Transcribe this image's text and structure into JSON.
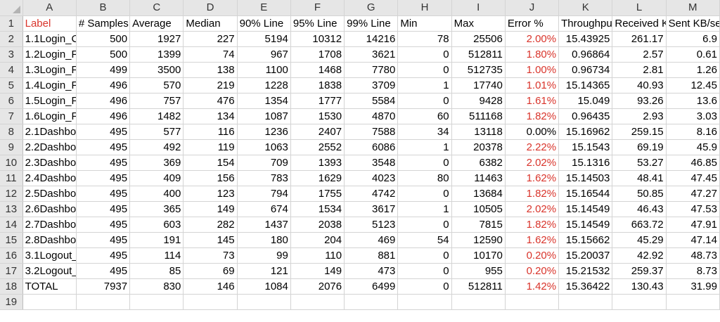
{
  "columns": [
    "A",
    "B",
    "C",
    "D",
    "E",
    "F",
    "G",
    "H",
    "I",
    "J",
    "K",
    "L",
    "M"
  ],
  "header_row": {
    "num": "1",
    "cells": [
      "Label",
      "# Samples",
      "Average",
      "Median",
      "90% Line",
      "95% Line",
      "99% Line",
      "Min",
      "Max",
      "Error %",
      "Throughput",
      "Received KB/sec",
      "Sent KB/sec"
    ]
  },
  "rows": [
    {
      "num": "2",
      "cells": [
        "1.1Login_C",
        "500",
        "1927",
        "227",
        "5194",
        "10312",
        "14216",
        "78",
        "25506",
        "2.00%",
        "15.43925",
        "261.17",
        "6.9"
      ]
    },
    {
      "num": "3",
      "cells": [
        "1.2Login_F",
        "500",
        "1399",
        "74",
        "967",
        "1708",
        "3621",
        "0",
        "512811",
        "1.80%",
        "0.96864",
        "2.57",
        "0.61"
      ]
    },
    {
      "num": "4",
      "cells": [
        "1.3Login_F",
        "499",
        "3500",
        "138",
        "1100",
        "1468",
        "7780",
        "0",
        "512735",
        "1.00%",
        "0.96734",
        "2.81",
        "1.26"
      ]
    },
    {
      "num": "5",
      "cells": [
        "1.4Login_F",
        "496",
        "570",
        "219",
        "1228",
        "1838",
        "3709",
        "1",
        "17740",
        "1.01%",
        "15.14365",
        "40.93",
        "12.45"
      ]
    },
    {
      "num": "6",
      "cells": [
        "1.5Login_F",
        "496",
        "757",
        "476",
        "1354",
        "1777",
        "5584",
        "0",
        "9428",
        "1.61%",
        "15.049",
        "93.26",
        "13.6"
      ]
    },
    {
      "num": "7",
      "cells": [
        "1.6Login_F",
        "496",
        "1482",
        "134",
        "1087",
        "1530",
        "4870",
        "60",
        "511168",
        "1.82%",
        "0.96435",
        "2.93",
        "3.03"
      ]
    },
    {
      "num": "8",
      "cells": [
        "2.1Dashbo",
        "495",
        "577",
        "116",
        "1236",
        "2407",
        "7588",
        "34",
        "13118",
        "0.00%",
        "15.16962",
        "259.15",
        "8.16"
      ]
    },
    {
      "num": "9",
      "cells": [
        "2.2Dashbo",
        "495",
        "492",
        "119",
        "1063",
        "2552",
        "6086",
        "1",
        "20378",
        "2.22%",
        "15.1543",
        "69.19",
        "45.9"
      ]
    },
    {
      "num": "10",
      "cells": [
        "2.3Dashbo",
        "495",
        "369",
        "154",
        "709",
        "1393",
        "3548",
        "0",
        "6382",
        "2.02%",
        "15.1316",
        "53.27",
        "46.85"
      ]
    },
    {
      "num": "11",
      "cells": [
        "2.4Dashbo",
        "495",
        "409",
        "156",
        "783",
        "1629",
        "4023",
        "80",
        "11463",
        "1.62%",
        "15.14503",
        "48.41",
        "47.45"
      ]
    },
    {
      "num": "12",
      "cells": [
        "2.5Dashbo",
        "495",
        "400",
        "123",
        "794",
        "1755",
        "4742",
        "0",
        "13684",
        "1.82%",
        "15.16544",
        "50.85",
        "47.27"
      ]
    },
    {
      "num": "13",
      "cells": [
        "2.6Dashbo",
        "495",
        "365",
        "149",
        "674",
        "1534",
        "3617",
        "1",
        "10505",
        "2.02%",
        "15.14549",
        "46.43",
        "47.53"
      ]
    },
    {
      "num": "14",
      "cells": [
        "2.7Dashbo",
        "495",
        "603",
        "282",
        "1437",
        "2038",
        "5123",
        "0",
        "7815",
        "1.82%",
        "15.14549",
        "663.72",
        "47.91"
      ]
    },
    {
      "num": "15",
      "cells": [
        "2.8Dashbo",
        "495",
        "191",
        "145",
        "180",
        "204",
        "469",
        "54",
        "12590",
        "1.62%",
        "15.15662",
        "45.29",
        "47.14"
      ]
    },
    {
      "num": "16",
      "cells": [
        "3.1Logout_",
        "495",
        "114",
        "73",
        "99",
        "110",
        "881",
        "0",
        "10170",
        "0.20%",
        "15.20037",
        "42.92",
        "48.73"
      ]
    },
    {
      "num": "17",
      "cells": [
        "3.2Logout_",
        "495",
        "85",
        "69",
        "121",
        "149",
        "473",
        "0",
        "955",
        "0.20%",
        "15.21532",
        "259.37",
        "8.73"
      ]
    },
    {
      "num": "18",
      "cells": [
        "TOTAL",
        "7937",
        "830",
        "146",
        "1084",
        "2076",
        "6499",
        "0",
        "512811",
        "1.42%",
        "15.36422",
        "130.43",
        "31.99"
      ]
    }
  ],
  "empty_row": {
    "num": "19"
  },
  "colors": {
    "error_text": "#d9342b",
    "header_bg": "#e6e6e6",
    "grid": "#d4d4d4"
  }
}
